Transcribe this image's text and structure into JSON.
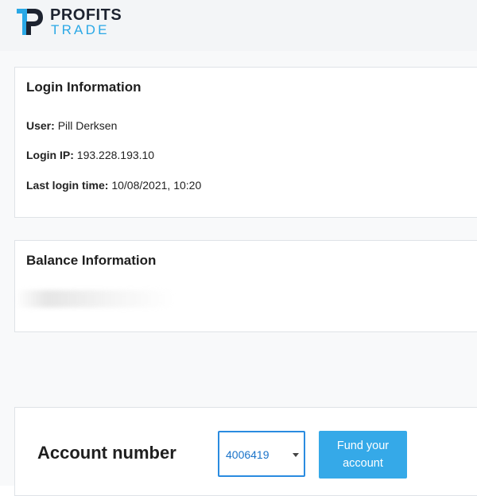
{
  "brand": {
    "line1": "PROFITS",
    "line2": "TRADE",
    "colors": {
      "dark": "#1d2330",
      "accent": "#2aa8e6"
    }
  },
  "login": {
    "title": "Login Information",
    "user_key": "User:",
    "user_val": "Pill Derksen",
    "ip_key": "Login IP:",
    "ip_val": "193.228.193.10",
    "time_key": "Last login time:",
    "time_val": "10/08/2021, 10:20"
  },
  "balance": {
    "title": "Balance Information"
  },
  "account": {
    "label": "Account number",
    "selected": "4006419",
    "fund_button": "Fund your account",
    "button_color": "#35a9e8"
  }
}
